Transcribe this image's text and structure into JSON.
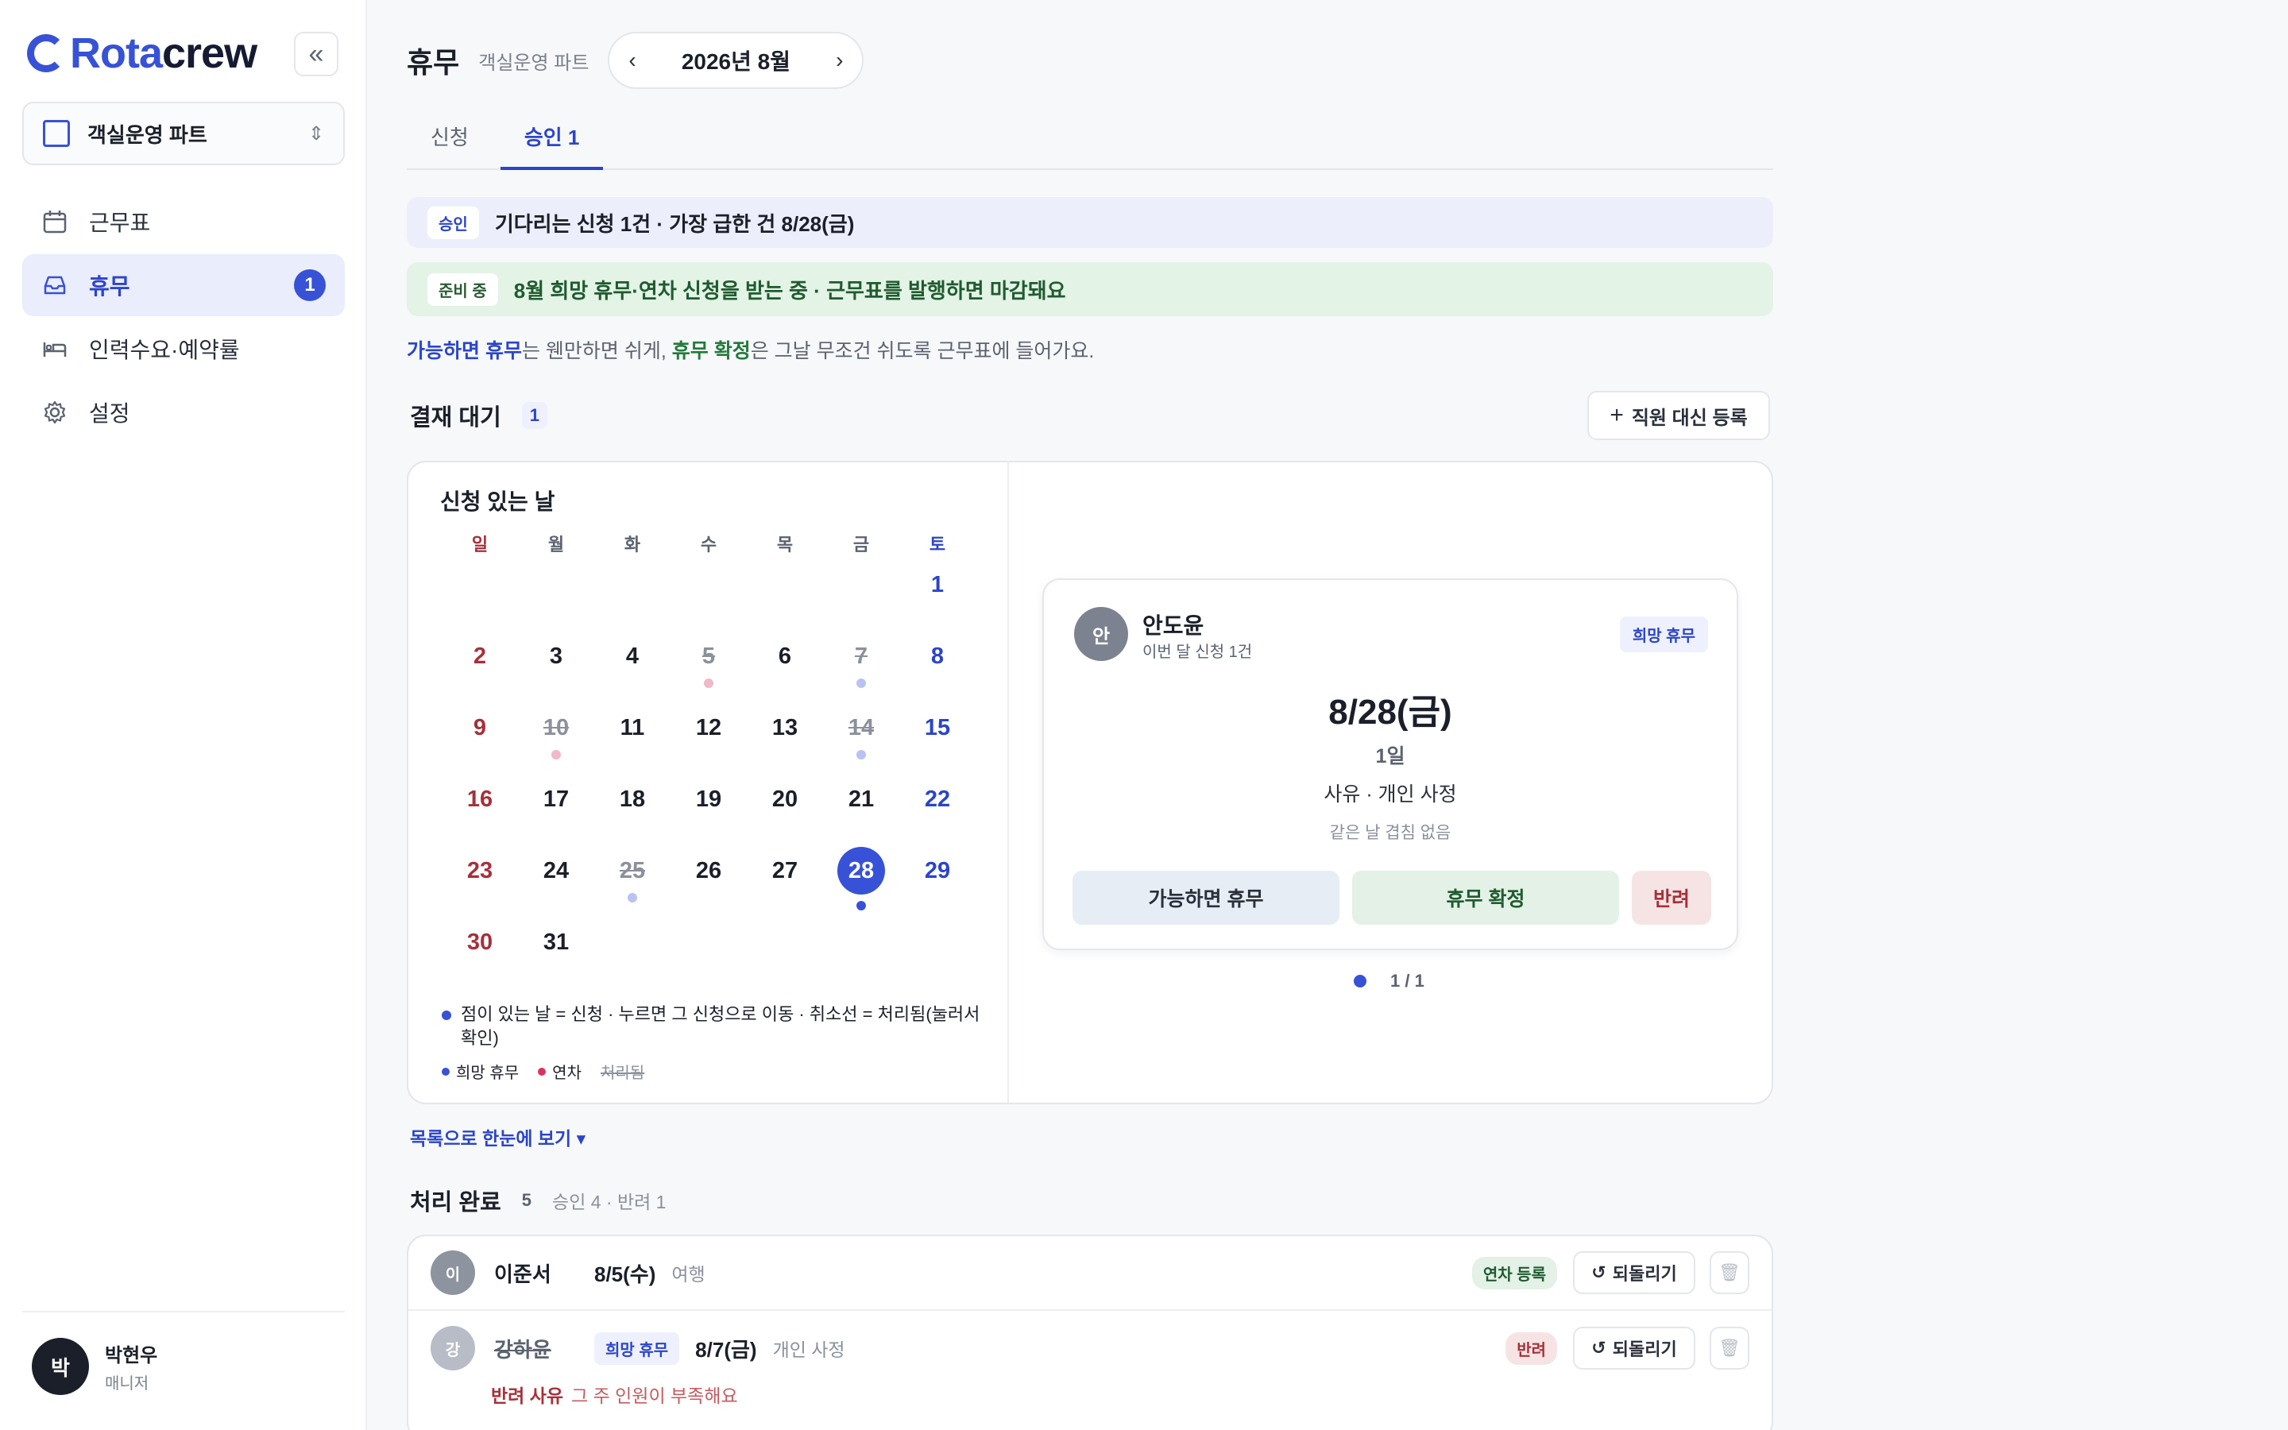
{
  "app": {
    "logo_text_a": "Rota",
    "logo_text_b": "crew"
  },
  "sidebar": {
    "collapse_label": "«",
    "team_selector": "객실운영 파트",
    "items": [
      {
        "label": "근무표",
        "icon": "calendar-icon"
      },
      {
        "label": "휴무",
        "icon": "inbox-icon",
        "badge": "1",
        "active": true
      },
      {
        "label": "인력수요·예약률",
        "icon": "bed-icon"
      },
      {
        "label": "설정",
        "icon": "gear-icon"
      }
    ],
    "user": {
      "initial": "박",
      "name": "박현우",
      "role": "매니저"
    }
  },
  "header": {
    "title": "휴무",
    "subtitle": "객실운영 파트",
    "month": "2026년 8월",
    "prev": "‹",
    "next": "›"
  },
  "tabs": [
    {
      "label": "신청"
    },
    {
      "label": "승인 1",
      "active": true
    }
  ],
  "banners": {
    "approval_pill": "승인",
    "approval_text": "기다리는 신청 1건 · 가장 급한 건 8/28(금)",
    "prep_pill": "준비 중",
    "prep_text": "8월 희망 휴무·연차 신청을 받는 중 · 근무표를 발행하면 마감돼요"
  },
  "hint": {
    "a": "가능하면 휴무",
    "b": "는 웬만하면 쉬게, ",
    "c": "휴무 확정",
    "d": "은 그날 무조건 쉬도록 근무표에 들어가요."
  },
  "pending": {
    "title": "결재 대기",
    "count": "1",
    "proxy_button": "직원 대신 등록"
  },
  "calendar": {
    "title": "신청 있는 날",
    "weekdays": [
      "일",
      "월",
      "화",
      "수",
      "목",
      "금",
      "토"
    ],
    "first_weekday": 6,
    "days_in_month": 31,
    "selected_day": 28,
    "processed_days": [
      5,
      7,
      10,
      14,
      25
    ],
    "dots": [
      {
        "day": 5,
        "kind": "annual",
        "faded": true
      },
      {
        "day": 7,
        "kind": "hope",
        "faded": true
      },
      {
        "day": 10,
        "kind": "annual",
        "faded": true
      },
      {
        "day": 14,
        "kind": "hope",
        "faded": true
      },
      {
        "day": 25,
        "kind": "hope",
        "faded": true
      },
      {
        "day": 28,
        "kind": "hope",
        "faded": false
      }
    ],
    "legend_text": "점이 있는 날 = 신청 · 누르면 그 신청으로 이동 · 취소선 = 처리됨(눌러서 확인)",
    "legend_hope": "희망 휴무",
    "legend_annual": "연차",
    "legend_done": "처리됨",
    "colors": {
      "hope": "#3752d6",
      "annual": "#d8345f"
    }
  },
  "request": {
    "initial": "안",
    "name": "안도윤",
    "sub": "이번 달 신청 1건",
    "tag": "희망 휴무",
    "date": "8/28(금)",
    "length": "1일",
    "reason": "사유 · 개인 사정",
    "overlap": "같은 날 겹침 없음",
    "btn_maybe": "가능하면 휴무",
    "btn_confirm": "휴무 확정",
    "btn_reject": "반려",
    "pager": "1 / 1"
  },
  "list_link": "목록으로 한눈에 보기 ▾",
  "done": {
    "title": "처리 완료",
    "count": "5",
    "meta": "승인 4 · 반려 1",
    "rows": [
      {
        "initial": "이",
        "name": "이준서",
        "date": "8/5(수)",
        "note": "여행",
        "badge": "연차 등록",
        "undo": "되돌리기"
      },
      {
        "initial": "강",
        "name": "강하윤",
        "tag": "희망 휴무",
        "date": "8/7(금)",
        "note": "개인 사정",
        "badge": "반려",
        "undo": "되돌리기",
        "reason_label": "반려 사유",
        "reason": "그 주 인원이 부족해요"
      }
    ]
  }
}
